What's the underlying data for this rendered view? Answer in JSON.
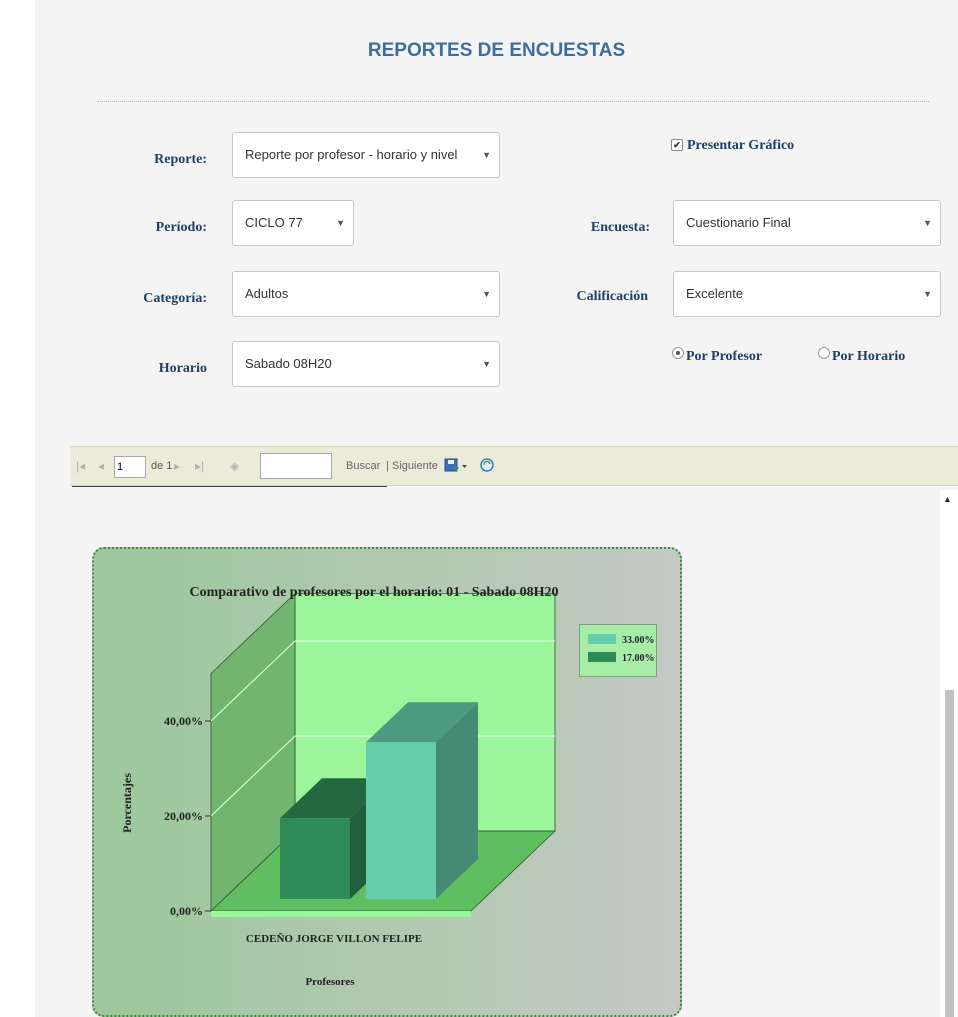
{
  "page": {
    "title": "REPORTES DE ENCUESTAS"
  },
  "form": {
    "reporte": {
      "label": "Reporte:",
      "value": "Reporte por profesor - horario y nivel"
    },
    "periodo": {
      "label": "Período:",
      "value": "CICLO 77"
    },
    "categoria": {
      "label": "Categoría:",
      "value": "Adultos"
    },
    "horario": {
      "label": "Horario",
      "value": "Sabado 08H20"
    },
    "encuesta": {
      "label": "Encuesta:",
      "value": "Cuestionario Final"
    },
    "calificacion": {
      "label": "Calificación",
      "value": "Excelente"
    },
    "presentar_grafico": {
      "label": "Presentar Gráfico",
      "checked": true
    },
    "radio_por_profesor": {
      "label": "Por Profesor",
      "selected": true
    },
    "radio_por_horario": {
      "label": "Por Horario",
      "selected": false
    }
  },
  "toolbar": {
    "first_icon": "first-page-icon",
    "prev_icon": "previous-page-icon",
    "page_value": "1",
    "page_of": "de 1",
    "next_icon": "next-page-icon",
    "last_icon": "last-page-icon",
    "back_icon": "back-icon",
    "find_value": "",
    "find_label": "Buscar",
    "next_label": "Siguiente",
    "find_separator": "|",
    "export_icon": "save-export-icon",
    "refresh_icon": "refresh-icon"
  },
  "chart_data": {
    "type": "bar",
    "title": "Comparativo de profesores por el horario: 01   - Sabado 08H20",
    "xlabel": "Profesores",
    "ylabel": "Porcentajes",
    "categories": [
      "CEDEÑO JORGE",
      "VILLON FELIPE"
    ],
    "values": [
      17,
      33
    ],
    "colors": [
      "#2e8b57",
      "#66cdaa"
    ],
    "legend": [
      "33.00%",
      "17.00%"
    ],
    "legend_colors": [
      "#66cdaa",
      "#2e8b57"
    ],
    "yticks": [
      "0,00%",
      "20,00%",
      "40,00%"
    ],
    "ylim": [
      0,
      50
    ],
    "legend_position": "top-right",
    "three_d": true
  }
}
